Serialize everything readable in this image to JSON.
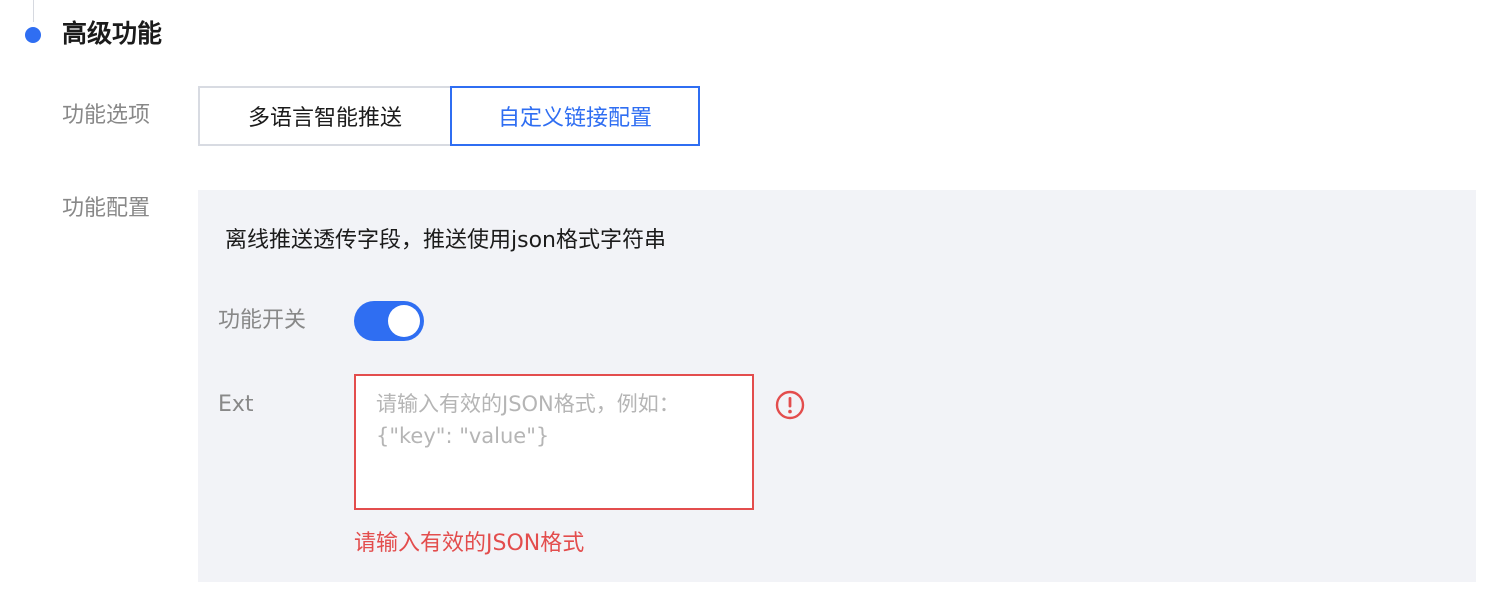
{
  "section": {
    "title": "高级功能"
  },
  "feature_options": {
    "label": "功能选项",
    "tabs": [
      {
        "label": "多语言智能推送",
        "active": false
      },
      {
        "label": "自定义链接配置",
        "active": true
      }
    ]
  },
  "feature_config": {
    "label": "功能配置",
    "description": "离线推送透传字段，推送使用json格式字符串",
    "switch": {
      "label": "功能开关",
      "on": true
    },
    "ext": {
      "label": "Ext",
      "value": "",
      "placeholder": "请输入有效的JSON格式，例如：{\"key\": \"value\"}",
      "error": "请输入有效的JSON格式",
      "status_icon": "warning-circle-icon"
    }
  },
  "colors": {
    "accent": "#2f6ef2",
    "error": "#e34d4d",
    "panel_bg": "#f2f3f7",
    "label": "#888888"
  }
}
